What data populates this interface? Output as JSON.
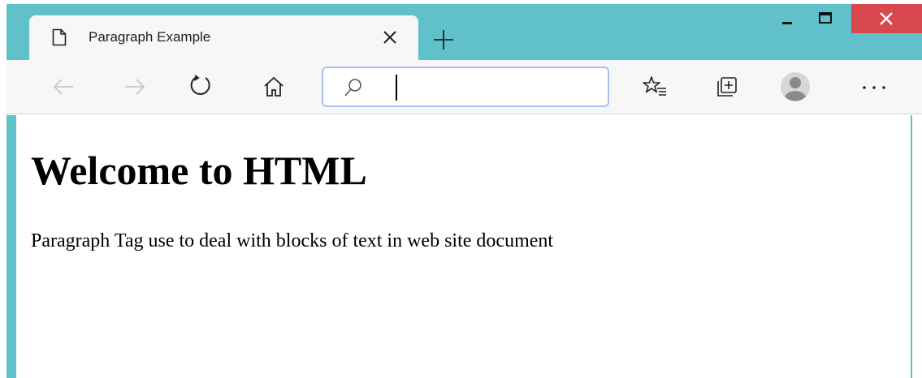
{
  "browser": {
    "tab": {
      "title": "Paragraph Example"
    },
    "toolbar": {
      "icons": [
        "back-icon",
        "forward-icon",
        "refresh-icon",
        "home-icon",
        "search-icon",
        "favorites-icon",
        "collections-icon",
        "profile-avatar",
        "more-icon"
      ],
      "address_value": "",
      "more_label": "···"
    },
    "colors": {
      "frame": "#60c1cb",
      "tab_bg": "#f7f7f7",
      "close_button": "#d9484e",
      "address_border": "#a7c0ec"
    }
  },
  "page": {
    "heading": "Welcome to HTML",
    "paragraph": "Paragraph Tag use to deal with blocks of text in web site document"
  }
}
